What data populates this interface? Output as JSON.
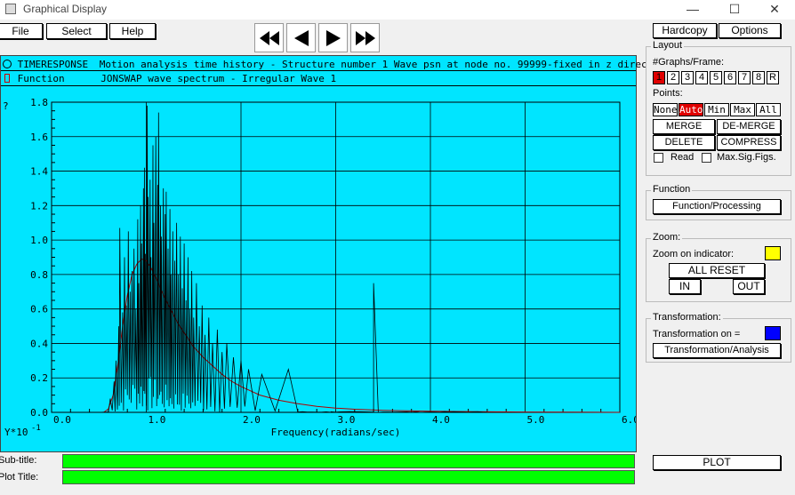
{
  "window": {
    "title": "Graphical Display",
    "minimize": "—",
    "maximize": "☐",
    "close": "✕"
  },
  "menu": {
    "file": "File",
    "select": "Select",
    "help": "Help"
  },
  "nav": {
    "first": "⏮",
    "prev": "◀",
    "next": "▶",
    "last": "⏭"
  },
  "header": {
    "line1_type": "TIMERESPONSE",
    "line1_text": "Motion analysis time history -  Structure number 1  Wave psn at node no. 99999-fixed  in z direc",
    "line2_type": "Function",
    "line2_text": "JONSWAP wave spectrum -  Irregular Wave 1"
  },
  "right_panel": {
    "hardcopy": "Hardcopy",
    "options": "Options",
    "layout_label": "Layout",
    "graphs_per_frame_label": "#Graphs/Frame:",
    "graphs_per_frame": [
      "1",
      "2",
      "3",
      "4",
      "5",
      "6",
      "7",
      "8",
      "R"
    ],
    "graphs_selected": "1",
    "points_label": "Points:",
    "points_options": [
      "None",
      "Auto",
      "Min",
      "Max",
      "All"
    ],
    "points_selected": "Auto",
    "merge": "MERGE",
    "demerge": "DE-MERGE",
    "delete": "DELETE",
    "compress": "COMPRESS",
    "read_label": "Read",
    "maxsig_label": "Max.Sig.Figs.",
    "function_label": "Function",
    "function_processing": "Function/Processing",
    "zoom_label": "Zoom:",
    "zoom_on_indicator": "Zoom on indicator:",
    "zoom_color": "#ffff00",
    "all_reset": "ALL  RESET",
    "zoom_in": "IN",
    "zoom_out": "OUT",
    "transformation_label": "Transformation:",
    "transformation_on": "Transformation on =",
    "transformation_color": "#0000ff",
    "transformation_analysis": "Transformation/Analysis",
    "plot": "PLOT"
  },
  "bottom": {
    "subtitle_label": "Sub-title:",
    "plot_title_label": "Plot Title:"
  },
  "chart_data": {
    "type": "line",
    "xlabel": "Frequency(radians/sec)",
    "ylabel": "?",
    "y_multiplier": "Y*10",
    "y_multiplier_exp": "-1",
    "xlim": [
      0.0,
      6.0
    ],
    "ylim": [
      0.0,
      1.8
    ],
    "x_ticks": [
      "0.0",
      "1.0",
      "2.0",
      "3.0",
      "4.0",
      "5.0",
      "6.0"
    ],
    "y_ticks": [
      "0.0",
      "0.2",
      "0.4",
      "0.6",
      "0.8",
      "1.0",
      "1.2",
      "1.4",
      "1.6",
      "1.8"
    ],
    "grid": true,
    "series": [
      {
        "kind": "spiky",
        "color": "#000000",
        "peaks": [
          [
            0.62,
            0.08
          ],
          [
            0.66,
            0.18
          ],
          [
            0.68,
            0.3
          ],
          [
            0.71,
            0.5
          ],
          [
            0.72,
            1.07
          ],
          [
            0.75,
            0.58
          ],
          [
            0.77,
            0.9
          ],
          [
            0.79,
            0.62
          ],
          [
            0.81,
            1.05
          ],
          [
            0.83,
            0.7
          ],
          [
            0.85,
            0.82
          ],
          [
            0.87,
            0.95
          ],
          [
            0.89,
            0.6
          ],
          [
            0.91,
            1.12
          ],
          [
            0.92,
            0.75
          ],
          [
            0.94,
            1.2
          ],
          [
            0.95,
            0.98
          ],
          [
            0.97,
            1.3
          ],
          [
            0.98,
            1.42
          ],
          [
            0.99,
            0.92
          ],
          [
            1.01,
            1.78
          ],
          [
            1.02,
            1.25
          ],
          [
            1.04,
            1.35
          ],
          [
            1.05,
            0.9
          ],
          [
            1.07,
            1.55
          ],
          [
            1.08,
            1.1
          ],
          [
            1.1,
            1.6
          ],
          [
            1.12,
            1.32
          ],
          [
            1.13,
            1.74
          ],
          [
            1.15,
            1.2
          ],
          [
            1.16,
            1.02
          ],
          [
            1.18,
            1.3
          ],
          [
            1.2,
            1.15
          ],
          [
            1.21,
            1.28
          ],
          [
            1.23,
            0.95
          ],
          [
            1.25,
            1.18
          ],
          [
            1.26,
            0.8
          ],
          [
            1.28,
            1.05
          ],
          [
            1.3,
            0.88
          ],
          [
            1.32,
            1.1
          ],
          [
            1.34,
            0.8
          ],
          [
            1.36,
            1.02
          ],
          [
            1.38,
            0.72
          ],
          [
            1.4,
            0.98
          ],
          [
            1.42,
            0.65
          ],
          [
            1.44,
            0.9
          ],
          [
            1.46,
            0.6
          ],
          [
            1.48,
            0.82
          ],
          [
            1.5,
            0.55
          ],
          [
            1.53,
            0.75
          ],
          [
            1.56,
            0.5
          ],
          [
            1.59,
            0.62
          ],
          [
            1.62,
            0.45
          ],
          [
            1.66,
            0.55
          ],
          [
            1.7,
            0.4
          ],
          [
            1.75,
            0.48
          ],
          [
            1.8,
            0.35
          ],
          [
            1.85,
            0.4
          ],
          [
            1.92,
            0.32
          ],
          [
            2.0,
            0.3
          ],
          [
            2.08,
            0.25
          ],
          [
            2.22,
            0.22
          ],
          [
            2.5,
            0.25
          ],
          [
            3.4,
            0.75
          ]
        ],
        "noise_end": 2.6,
        "noise_end2": 4.6
      },
      {
        "kind": "smooth",
        "color": "#b00000",
        "x": [
          0.55,
          0.6,
          0.65,
          0.7,
          0.75,
          0.8,
          0.85,
          0.9,
          0.95,
          1.0,
          1.05,
          1.1,
          1.15,
          1.2,
          1.3,
          1.4,
          1.5,
          1.6,
          1.7,
          1.8,
          1.9,
          2.0,
          2.2,
          2.4,
          2.6,
          2.8,
          3.0,
          3.2,
          3.5,
          4.0,
          4.5,
          5.0,
          5.5,
          6.0
        ],
        "y": [
          0.0,
          0.02,
          0.1,
          0.28,
          0.5,
          0.68,
          0.8,
          0.86,
          0.89,
          0.88,
          0.84,
          0.78,
          0.72,
          0.66,
          0.55,
          0.46,
          0.38,
          0.32,
          0.27,
          0.22,
          0.18,
          0.15,
          0.1,
          0.07,
          0.05,
          0.035,
          0.025,
          0.018,
          0.012,
          0.006,
          0.004,
          0.002,
          0.001,
          0.0
        ]
      }
    ]
  }
}
